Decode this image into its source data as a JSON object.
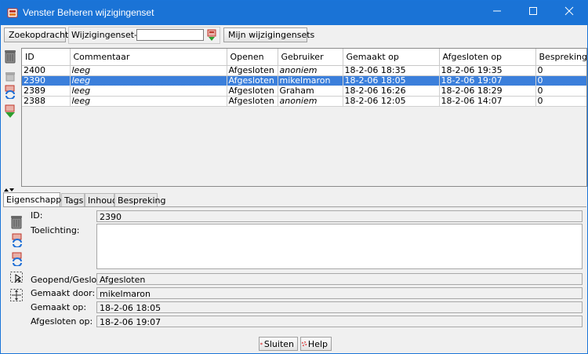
{
  "window": {
    "title": "Venster Beheren wijzigingenset",
    "minimize": "—",
    "maximize": "☐",
    "close": "✕"
  },
  "toolbar": {
    "search_button": "Zoekopdracht",
    "changeset_id_label": "Wijzigingenset-ID:",
    "changeset_id_value": "",
    "my_changesets_button": "Mijn wijzigingensets"
  },
  "table": {
    "columns": [
      "ID",
      "Commentaar",
      "Openen",
      "Gebruiker",
      "Gemaakt op",
      "Afgesloten op",
      "Besprekingen"
    ],
    "rows": [
      {
        "id": "2400",
        "comment": "leeg",
        "open": "Afgesloten",
        "user": "anoniem",
        "created": "18-2-06 18:35",
        "closed": "18-2-06 19:35",
        "discussions": "0"
      },
      {
        "id": "2390",
        "comment": "leeg",
        "open": "Afgesloten",
        "user": "mikelmaron",
        "created": "18-2-06 18:05",
        "closed": "18-2-06 19:07",
        "discussions": "0"
      },
      {
        "id": "2389",
        "comment": "leeg",
        "open": "Afgesloten",
        "user": "Graham",
        "created": "18-2-06 16:26",
        "closed": "18-2-06 18:29",
        "discussions": "0"
      },
      {
        "id": "2388",
        "comment": "leeg",
        "open": "Afgesloten",
        "user": "anoniem",
        "created": "18-2-06 12:05",
        "closed": "18-2-06 14:07",
        "discussions": "0"
      }
    ],
    "selected_row": 1
  },
  "tabs": [
    "Eigenschappen",
    "Tags",
    "Inhoud",
    "Bespreking"
  ],
  "details": {
    "id_label": "ID:",
    "id_value": "2390",
    "comment_label": "Toelichting:",
    "comment_value": "",
    "state_label": "Geopend/Gesloten:",
    "state_value": "Afgesloten",
    "created_by_label": "Gemaakt door:",
    "created_by_value": "mikelmaron",
    "created_at_label": "Gemaakt op:",
    "created_at_value": "18-2-06 18:05",
    "closed_at_label": "Afgesloten op:",
    "closed_at_value": "18-2-06 19:07"
  },
  "footer": {
    "close_button": "Sluiten",
    "help_button": "Help"
  },
  "colors": {
    "titlebar": "#1a73d6",
    "selection": "#3b7fdb",
    "window_bg": "#f0f0f0"
  }
}
